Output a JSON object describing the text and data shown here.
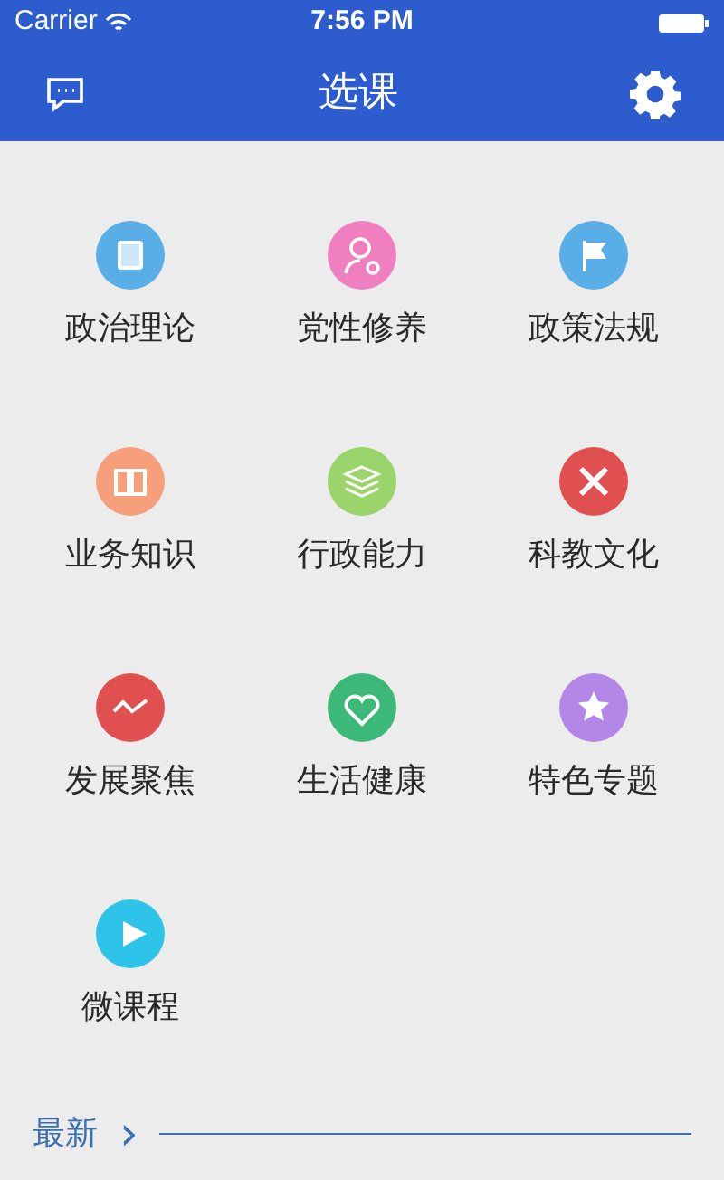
{
  "status_bar": {
    "carrier": "Carrier",
    "time": "7:56 PM"
  },
  "nav_bar": {
    "title": "选课"
  },
  "categories": [
    {
      "label": "政治理论",
      "color": "#5aaee8"
    },
    {
      "label": "党性修养",
      "color": "#f07fc0"
    },
    {
      "label": "政策法规",
      "color": "#5aaee8"
    },
    {
      "label": "业务知识",
      "color": "#f5a07a"
    },
    {
      "label": "行政能力",
      "color": "#9ad46a"
    },
    {
      "label": "科教文化",
      "color": "#e05050"
    },
    {
      "label": "发展聚焦",
      "color": "#e05050"
    },
    {
      "label": "生活健康",
      "color": "#3cb878"
    },
    {
      "label": "特色专题",
      "color": "#b387e8"
    },
    {
      "label": "微课程",
      "color": "#2ec3e8"
    }
  ],
  "footer": {
    "label": "最新",
    "arrow": "›"
  }
}
